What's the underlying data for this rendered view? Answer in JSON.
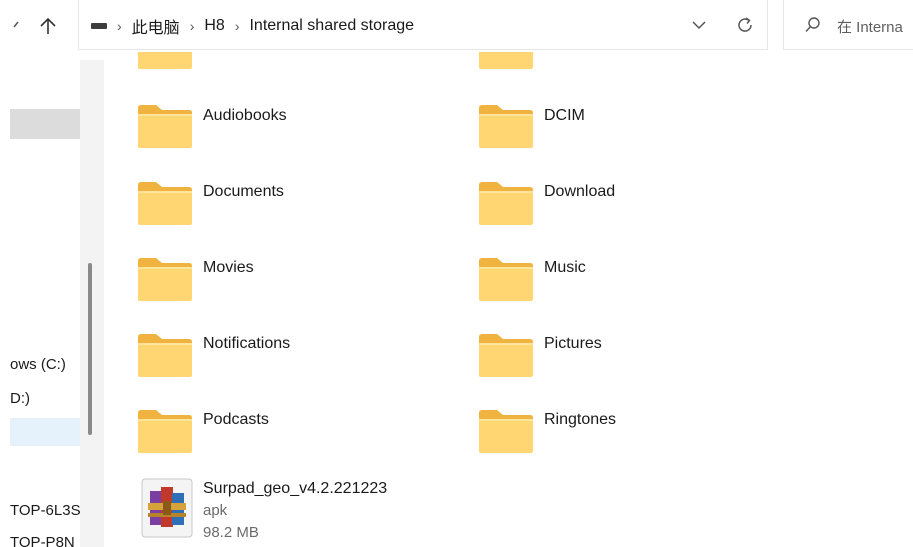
{
  "toolbar": {
    "back_icon": "chevron-icon",
    "up_icon": "arrow-up-icon",
    "dropdown_icon": "chevron-down-icon",
    "refresh_icon": "refresh-icon"
  },
  "address": {
    "drive_icon": "drive-icon",
    "crumbs": [
      "此电脑",
      "H8",
      "Internal shared storage"
    ]
  },
  "search": {
    "icon": "search-icon",
    "placeholder": "在 Interna"
  },
  "sidebar": {
    "items": [
      {
        "label": "ows (C:)"
      },
      {
        "label": "D:)"
      },
      {
        "label": "TOP-6L3S"
      },
      {
        "label": "TOP-P8N"
      }
    ]
  },
  "folders": [
    {
      "label": ""
    },
    {
      "label": ""
    },
    {
      "label": "Audiobooks"
    },
    {
      "label": "DCIM"
    },
    {
      "label": "Documents"
    },
    {
      "label": "Download"
    },
    {
      "label": "Movies"
    },
    {
      "label": "Music"
    },
    {
      "label": "Notifications"
    },
    {
      "label": "Pictures"
    },
    {
      "label": "Podcasts"
    },
    {
      "label": "Ringtones"
    }
  ],
  "file": {
    "icon": "archive-icon",
    "name": "Surpad_geo_v4.2.221223",
    "type": "apk",
    "size": "98.2 MB"
  },
  "colors": {
    "folder_back": "#f0b33f",
    "folder_front": "#ffd671",
    "selection": "#dcdcdc",
    "highlight": "#e5f1fb"
  }
}
